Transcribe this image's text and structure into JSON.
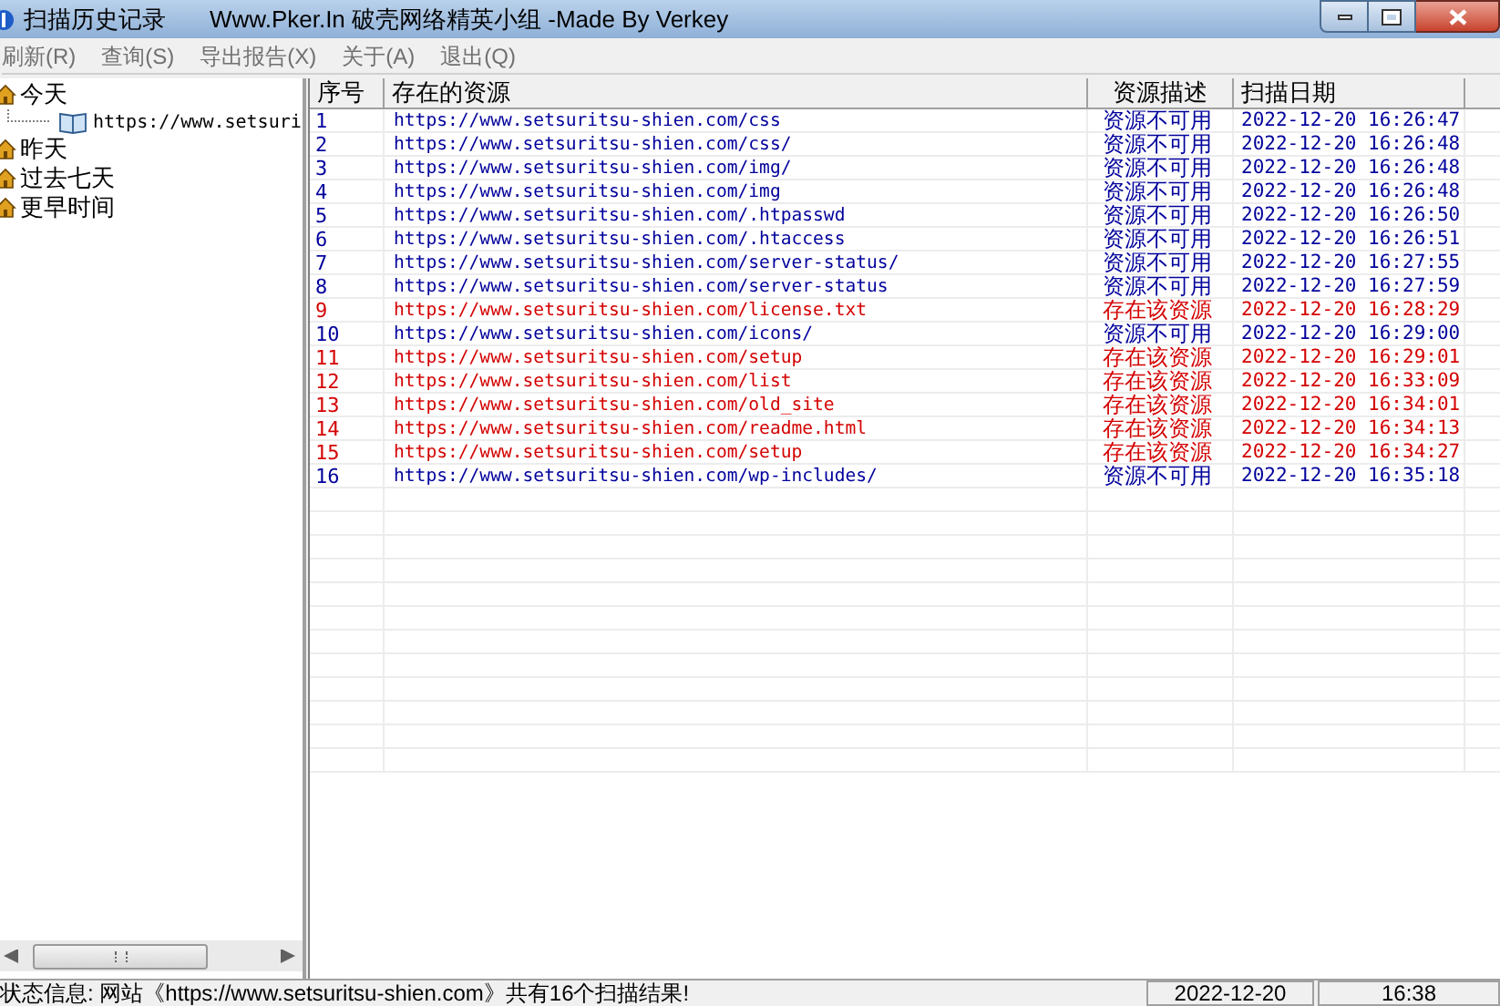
{
  "window": {
    "title": "扫描历史记录",
    "subtitle": "Www.Pker.In  破壳网络精英小组 -Made By Verkey"
  },
  "menu": [
    "刷新(R)",
    "查询(S)",
    "导出报告(X)",
    "关于(A)",
    "退出(Q)"
  ],
  "tree": [
    {
      "label": "今天",
      "children": [
        {
          "label": "https://www.setsuri"
        }
      ]
    },
    {
      "label": "昨天"
    },
    {
      "label": "过去七天"
    },
    {
      "label": "更早时间"
    }
  ],
  "table": {
    "columns": [
      "序号",
      "存在的资源",
      "资源描述",
      "扫描日期"
    ],
    "rows": [
      {
        "kind": "unavailable",
        "no": "1",
        "url": "https://www.setsuritsu-shien.com/css",
        "desc": "资源不可用",
        "date": "2022-12-20 16:26:47"
      },
      {
        "kind": "unavailable",
        "no": "2",
        "url": "https://www.setsuritsu-shien.com/css/",
        "desc": "资源不可用",
        "date": "2022-12-20 16:26:48"
      },
      {
        "kind": "unavailable",
        "no": "3",
        "url": "https://www.setsuritsu-shien.com/img/",
        "desc": "资源不可用",
        "date": "2022-12-20 16:26:48"
      },
      {
        "kind": "unavailable",
        "no": "4",
        "url": "https://www.setsuritsu-shien.com/img",
        "desc": "资源不可用",
        "date": "2022-12-20 16:26:48"
      },
      {
        "kind": "unavailable",
        "no": "5",
        "url": "https://www.setsuritsu-shien.com/.htpasswd",
        "desc": "资源不可用",
        "date": "2022-12-20 16:26:50"
      },
      {
        "kind": "unavailable",
        "no": "6",
        "url": "https://www.setsuritsu-shien.com/.htaccess",
        "desc": "资源不可用",
        "date": "2022-12-20 16:26:51"
      },
      {
        "kind": "unavailable",
        "no": "7",
        "url": "https://www.setsuritsu-shien.com/server-status/",
        "desc": "资源不可用",
        "date": "2022-12-20 16:27:55"
      },
      {
        "kind": "unavailable",
        "no": "8",
        "url": "https://www.setsuritsu-shien.com/server-status",
        "desc": "资源不可用",
        "date": "2022-12-20 16:27:59"
      },
      {
        "kind": "exists",
        "no": "9",
        "url": "https://www.setsuritsu-shien.com/license.txt",
        "desc": "存在该资源",
        "date": "2022-12-20 16:28:29"
      },
      {
        "kind": "unavailable",
        "no": "10",
        "url": "https://www.setsuritsu-shien.com/icons/",
        "desc": "资源不可用",
        "date": "2022-12-20 16:29:00"
      },
      {
        "kind": "exists",
        "no": "11",
        "url": "https://www.setsuritsu-shien.com/setup",
        "desc": "存在该资源",
        "date": "2022-12-20 16:29:01"
      },
      {
        "kind": "exists",
        "no": "12",
        "url": "https://www.setsuritsu-shien.com/list",
        "desc": "存在该资源",
        "date": "2022-12-20 16:33:09"
      },
      {
        "kind": "exists",
        "no": "13",
        "url": "https://www.setsuritsu-shien.com/old_site",
        "desc": "存在该资源",
        "date": "2022-12-20 16:34:01"
      },
      {
        "kind": "exists",
        "no": "14",
        "url": "https://www.setsuritsu-shien.com/readme.html",
        "desc": "存在该资源",
        "date": "2022-12-20 16:34:13"
      },
      {
        "kind": "exists",
        "no": "15",
        "url": "https://www.setsuritsu-shien.com/setup",
        "desc": "存在该资源",
        "date": "2022-12-20 16:34:27"
      },
      {
        "kind": "unavailable",
        "no": "16",
        "url": "https://www.setsuritsu-shien.com/wp-includes/",
        "desc": "资源不可用",
        "date": "2022-12-20 16:35:18"
      }
    ]
  },
  "status_bar": {
    "message": "状态信息: 网站《https://www.setsuritsu-shien.com》共有16个扫描结果!",
    "date": "2022-12-20",
    "time": "16:38"
  }
}
